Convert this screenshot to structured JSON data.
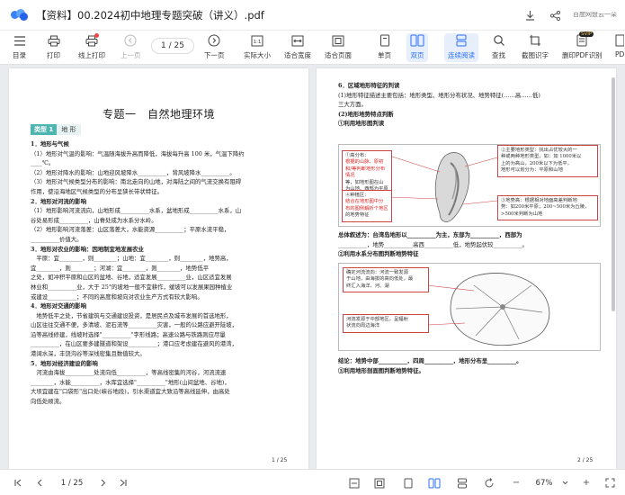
{
  "app": {
    "title": "【资料】00.2024初中地理专题突破（讲义）.pdf",
    "brand": "百度网盘云一朵"
  },
  "toolbar": {
    "items": [
      {
        "label": "目录"
      },
      {
        "label": "打印"
      },
      {
        "label": "线上打印"
      },
      {
        "label": "上一页"
      },
      {
        "label": "下一页"
      },
      {
        "label": "实际大小"
      },
      {
        "label": "适合宽度"
      },
      {
        "label": "适合页面"
      },
      {
        "label": "单页"
      },
      {
        "label": "双页"
      },
      {
        "label": "连续阅读"
      },
      {
        "label": "查找"
      },
      {
        "label": "截图识字"
      },
      {
        "label": "删印PDF识别"
      },
      {
        "label": "PD"
      }
    ],
    "page_indicator": "1  / 25",
    "svip_badge": "SVIP"
  },
  "left_page": {
    "title": "专题一　自然地理环境",
    "category_badge": "类型 1",
    "category_label": "地 形",
    "lines": [
      {
        "t": "1．地形与气候",
        "h": true
      },
      {
        "t": "（1）地形对气温的影响：气温随海拔升高而降低，海拔每升高 100 米，气温下降约",
        "h": false
      },
      {
        "t": "____℃。",
        "h": false
      },
      {
        "t": "（2）地形对降水的影响：山地迎风坡降水__________，背风坡降水__________。",
        "h": false
      },
      {
        "t": "（3）地形对气候类型分布的影响：南北走向的山地，对海陆之间的气流交换有阻碍",
        "h": false
      },
      {
        "t": "作用，使沿海地区气候类型的分布呈狭长带状特征。",
        "h": false
      },
      {
        "t": "2．地形对河流的影响",
        "h": true
      },
      {
        "t": "（1）地形影响河流流向，山地形成__________水系，盆地形成__________水系，山",
        "h": false
      },
      {
        "t": "谷处易形成__________，山脊处成为水系分水岭。",
        "h": false
      },
      {
        "t": "（2）地形影响河流落差：山区落差大，水能资源__________；平原水流平稳，",
        "h": false
      },
      {
        "t": "__________价值大。",
        "h": false
      },
      {
        "t": "3．地形对农业的影响：因地制宜地发展农业",
        "h": true
      },
      {
        "t": "　平原：宜________，则________；山地：宜________，则________，地势高，",
        "h": false
      },
      {
        "t": "宜________，则________；河湖：宜________，则________，地势低平",
        "h": false
      },
      {
        "t": "之处，如冲积平原和山区的盆地、谷地，适宜发展__________业，山区适宜发展",
        "h": false
      },
      {
        "t": "林业和__________业，大于 25°的坡地一般不宜耕作，缓坡可以发展果园种植业",
        "h": false
      },
      {
        "t": "或建设__________；不同的高度和坡向对农业生产方式有较大影响。",
        "h": false
      },
      {
        "t": "4．地形对交通的影响",
        "h": true
      },
      {
        "t": "　地势低平之处，节省建筑与交通建设投资，是居民点及城市发展的首选地形，",
        "h": false
      },
      {
        "t": "山区往往交通不便，多清坡、泥石流等__________灾害，一般的公路应避开陡坡，",
        "h": false
      },
      {
        "t": "沿等高线修建，线坡时选择\"__________\"字形线路；高速公路与铁路则应尽量",
        "h": false
      },
      {
        "t": "__________，在山区要多建隧道和架设__________；港口应考虑建在避风的港湾，",
        "h": false
      },
      {
        "t": "港阔水深，丰饶沟谷等深线密集且数值较大。",
        "h": false
      },
      {
        "t": "5．地形对经济建设的影响",
        "h": true
      },
      {
        "t": "　河流由海拔__________处流向低__________，等高线密集的河谷，河流流速",
        "h": false
      },
      {
        "t": "________，水能__________，水库宜选择\"__________\"地形(山间盆地、谷地)，",
        "h": false
      },
      {
        "t": "大坝宜建在\"口袋形\"出口处(峡谷地段)，引水渠道宜大致沿等高线延伸，由高处",
        "h": false
      },
      {
        "t": "向低处顺流。",
        "h": false
      }
    ],
    "page_number": "1 / 25"
  },
  "right_page": {
    "lines_top": [
      {
        "t": "6．区域地形特征的判读",
        "h": true
      },
      {
        "t": "(1)地形特征描述主要包括：地形类型、地形分布状况、地势特征(……高……低)",
        "h": false
      },
      {
        "t": "三大方面。",
        "h": false
      },
      {
        "t": "(2)地形地势特点判断",
        "h": true
      },
      {
        "t": "①利用地形图判读",
        "h": true
      }
    ],
    "fig1_left_a": [
      "①高分布：",
      "根据的山脉、原初",
      "和/等判断地形分布情况",
      "等，如地形图在山",
      "为山地、西部为平原"
    ],
    "fig1_left_b": [
      "④种植区：",
      "结合在地形图中分",
      "布的图例解析个地区",
      "的地势特征"
    ],
    "fig1_right_a": [
      "②主要地形类型：找出占优较大的一",
      "种或两种地形类型，如：如 1000米以",
      "上的为高山，200米以下为低平，",
      "地形可以划分为：平原和山地"
    ],
    "fig1_right_b": [
      "③地势高：根据相对地面高差判断地",
      "势：如200米平原；200~500米为丘陵，",
      ">500米判断为山地"
    ],
    "mid_lines": [
      {
        "t": "总体叙述为：台湾岛地形以__________为主，东部为__________，西部为",
        "h": true
      },
      {
        "t": "__________，地势__________高西__________低，地势起伏较__________。",
        "h": false
      },
      {
        "t": "②利用水系分布图判断地势特征",
        "h": true
      }
    ],
    "fig2_a": [
      "确定河流流向：河流一致发源",
      "于山地，由海拔的高向低处，最",
      "终汇入海洋、河、湖"
    ],
    "fig2_b": [
      "河流发源于中部地区，呈辐射",
      "状流向周边海洋"
    ],
    "bottom_lines": [
      {
        "t": "结论：地势中部__________，四周__________，地形分布呈__________。",
        "h": true
      },
      {
        "t": "③利用地形剖面图判断地势特征。",
        "h": true
      }
    ],
    "page_number": "2 / 25"
  },
  "bottombar": {
    "page_indicator": "1 / 25",
    "zoom": "67%",
    "zoom_minus": "−",
    "zoom_plus": "+"
  },
  "colors": {
    "accent": "#2a6ef5",
    "badge": "#4fb5b0",
    "annotation_red": "#d22222"
  }
}
